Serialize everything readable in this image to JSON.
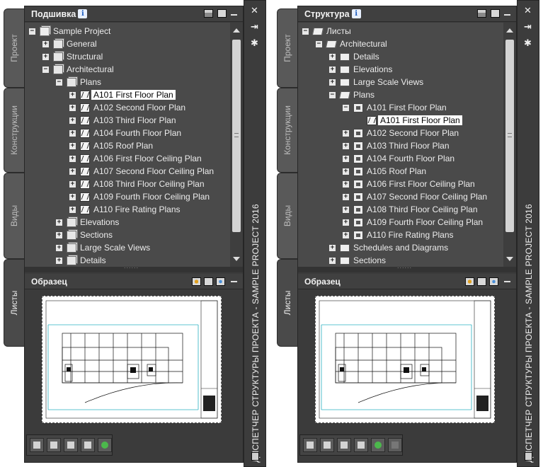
{
  "strip_caption": "ДИСПЕТЧЕР СТРУКТУРЫ ПРОЕКТА - SAMPLE PROJECT 2016",
  "preview_title": "Образец",
  "left": {
    "title": "Подшивка",
    "tabs": [
      "Проект",
      "Конструкции",
      "Виды",
      "Листы"
    ],
    "tree": [
      {
        "label": "Sample Project",
        "level": 0,
        "exp": "−",
        "icon": "sheetset"
      },
      {
        "label": "General",
        "level": 1,
        "exp": "+",
        "icon": "subset"
      },
      {
        "label": "Structural",
        "level": 1,
        "exp": "+",
        "icon": "subset"
      },
      {
        "label": "Architectural",
        "level": 1,
        "exp": "−",
        "icon": "subset"
      },
      {
        "label": "Plans",
        "level": 2,
        "exp": "−",
        "icon": "subset"
      },
      {
        "label": "A101 First Floor Plan",
        "level": 3,
        "exp": "+",
        "icon": "sheet",
        "selected": true
      },
      {
        "label": "A102 Second Floor Plan",
        "level": 3,
        "exp": "+",
        "icon": "sheet"
      },
      {
        "label": "A103 Third Floor Plan",
        "level": 3,
        "exp": "+",
        "icon": "sheet"
      },
      {
        "label": "A104 Fourth Floor Plan",
        "level": 3,
        "exp": "+",
        "icon": "sheet"
      },
      {
        "label": "A105 Roof Plan",
        "level": 3,
        "exp": "+",
        "icon": "sheet"
      },
      {
        "label": "A106 First Floor Ceiling Plan",
        "level": 3,
        "exp": "+",
        "icon": "sheet"
      },
      {
        "label": "A107 Second Floor Ceiling Plan",
        "level": 3,
        "exp": "+",
        "icon": "sheet"
      },
      {
        "label": "A108 Third Floor Ceiling Plan",
        "level": 3,
        "exp": "+",
        "icon": "sheet"
      },
      {
        "label": "A109 Fourth Floor Ceiling Plan",
        "level": 3,
        "exp": "+",
        "icon": "sheet"
      },
      {
        "label": "A110 Fire Rating Plans",
        "level": 3,
        "exp": "+",
        "icon": "sheet"
      },
      {
        "label": "Elevations",
        "level": 2,
        "exp": "+",
        "icon": "subset"
      },
      {
        "label": "Sections",
        "level": 2,
        "exp": "+",
        "icon": "subset"
      },
      {
        "label": "Large Scale Views",
        "level": 2,
        "exp": "+",
        "icon": "subset"
      },
      {
        "label": "Details",
        "level": 2,
        "exp": "+",
        "icon": "subset"
      }
    ]
  },
  "right": {
    "title": "Структура",
    "tabs": [
      "Проект",
      "Конструкции",
      "Виды",
      "Листы"
    ],
    "tree": [
      {
        "label": "Листы",
        "level": 0,
        "exp": "−",
        "icon": "folder-open"
      },
      {
        "label": "Architectural",
        "level": 1,
        "exp": "−",
        "icon": "folder-open"
      },
      {
        "label": "Details",
        "level": 2,
        "exp": "+",
        "icon": "folder"
      },
      {
        "label": "Elevations",
        "level": 2,
        "exp": "+",
        "icon": "folder"
      },
      {
        "label": "Large Scale Views",
        "level": 2,
        "exp": "+",
        "icon": "folder"
      },
      {
        "label": "Plans",
        "level": 2,
        "exp": "−",
        "icon": "folder-open"
      },
      {
        "label": "A101 First Floor Plan",
        "level": 3,
        "exp": "−",
        "icon": "view"
      },
      {
        "label": "A101 First Floor Plan",
        "level": 4,
        "exp": "",
        "icon": "sheet",
        "selected": true
      },
      {
        "label": "A102 Second Floor Plan",
        "level": 3,
        "exp": "+",
        "icon": "view"
      },
      {
        "label": "A103 Third Floor Plan",
        "level": 3,
        "exp": "+",
        "icon": "view"
      },
      {
        "label": "A104 Fourth Floor Plan",
        "level": 3,
        "exp": "+",
        "icon": "view"
      },
      {
        "label": "A105 Roof Plan",
        "level": 3,
        "exp": "+",
        "icon": "view"
      },
      {
        "label": "A106 First Floor Ceiling Plan",
        "level": 3,
        "exp": "+",
        "icon": "view"
      },
      {
        "label": "A107 Second Floor Ceiling Plan",
        "level": 3,
        "exp": "+",
        "icon": "view"
      },
      {
        "label": "A108 Third Floor Ceiling Plan",
        "level": 3,
        "exp": "+",
        "icon": "view"
      },
      {
        "label": "A109 Fourth Floor Ceiling Plan",
        "level": 3,
        "exp": "+",
        "icon": "view"
      },
      {
        "label": "A110 Fire Rating Plans",
        "level": 3,
        "exp": "+",
        "icon": "view"
      },
      {
        "label": "Schedules and Diagrams",
        "level": 2,
        "exp": "+",
        "icon": "folder"
      },
      {
        "label": "Sections",
        "level": 2,
        "exp": "+",
        "icon": "folder"
      }
    ]
  }
}
